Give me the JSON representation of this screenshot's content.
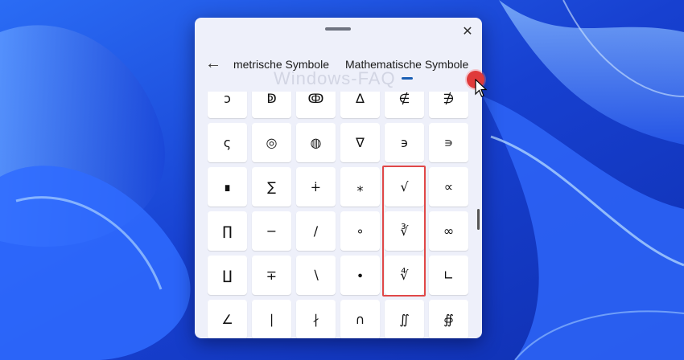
{
  "header": {
    "close_icon": "✕",
    "back_icon": "←",
    "tabs": [
      {
        "label": "metrische Symbole"
      },
      {
        "label": "Mathematische Symbole"
      }
    ],
    "watermark": "Windows-FAQ"
  },
  "symbols": [
    "ↄ",
    "ↁ",
    "ↂ",
    "∆",
    "∉",
    "∌",
    "ς",
    "◎",
    "◍",
    "∇",
    "϶",
    "∍",
    "∎",
    "∑",
    "∔",
    "⁎",
    "√",
    "∝",
    "∏",
    "−",
    "∕",
    "∘",
    "∛",
    "∞",
    "∐",
    "∓",
    "∖",
    "∙",
    "∜",
    "∟",
    "∠",
    "∣",
    "∤",
    "∩",
    "∬",
    "∯"
  ],
  "colors": {
    "accent": "#1a5fb4",
    "highlight": "#e04848",
    "cursor": "#e03a3a"
  }
}
